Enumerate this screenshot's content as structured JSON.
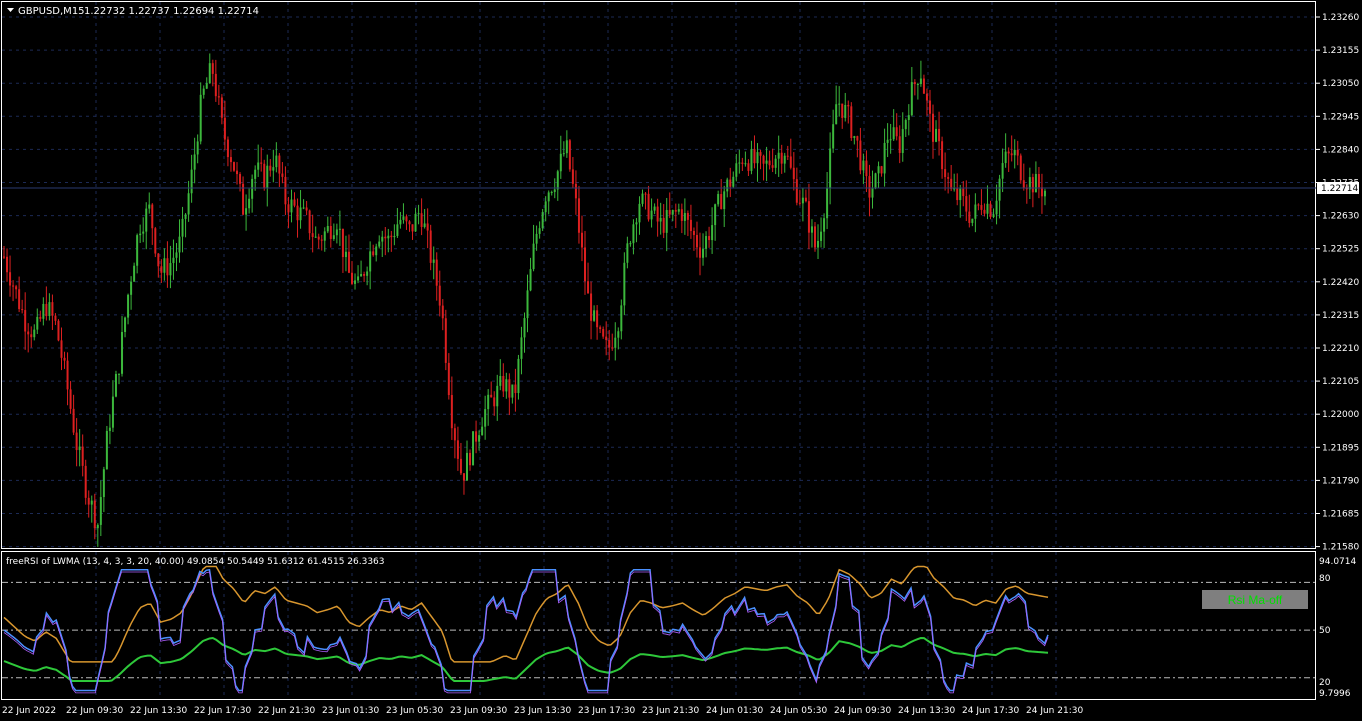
{
  "header": {
    "symbol": "GBPUSD,M15",
    "ohlc": "1.22732 1.22737 1.22694 1.22714"
  },
  "price_axis": {
    "labels": [
      "1.23260",
      "1.23155",
      "1.23050",
      "1.22945",
      "1.22840",
      "1.22735",
      "1.22630",
      "1.22525",
      "1.22420",
      "1.22315",
      "1.22210",
      "1.22105",
      "1.22000",
      "1.21895",
      "1.21790",
      "1.21685",
      "1.21580"
    ],
    "current": "1.22714"
  },
  "indicator": {
    "title": "freeRSI of LWMA (13, 4, 3, 3, 20, 40.00) 49.0854 50.5449 51.6312 61.4515 26.3363",
    "top": "94.0714",
    "levels": [
      "80",
      "50",
      "20"
    ],
    "bottom": "9.7996",
    "button_label": "Rsi Ma-off"
  },
  "time_axis": [
    "22 Jun 2022",
    "22 Jun 09:30",
    "22 Jun 13:30",
    "22 Jun 17:30",
    "22 Jun 21:30",
    "23 Jun 01:30",
    "23 Jun 05:30",
    "23 Jun 09:30",
    "23 Jun 13:30",
    "23 Jun 17:30",
    "23 Jun 21:30",
    "24 Jun 01:30",
    "24 Jun 05:30",
    "24 Jun 09:30",
    "24 Jun 13:30",
    "24 Jun 17:30",
    "24 Jun 21:30"
  ],
  "colors": {
    "bull": "#3cb83c",
    "bear": "#dd2020",
    "rsi_orange": "#d8962e",
    "rsi_green": "#2ec83a",
    "rsi_blue": "#4a90ff",
    "grid": "#1c2a55"
  },
  "chart_data": {
    "type": "candlestick",
    "symbol": "GBPUSD",
    "timeframe": "M15",
    "close_path": [
      1.225,
      1.224,
      1.223,
      1.2225,
      1.2235,
      1.2228,
      1.221,
      1.219,
      1.2175,
      1.2165,
      1.2195,
      1.2215,
      1.224,
      1.226,
      1.2265,
      1.2245,
      1.2248,
      1.2255,
      1.2275,
      1.23,
      1.231,
      1.229,
      1.228,
      1.2265,
      1.2278,
      1.2275,
      1.2282,
      1.2268,
      1.2265,
      1.2262,
      1.2255,
      1.2258,
      1.2262,
      1.2245,
      1.224,
      1.225,
      1.2258,
      1.2255,
      1.2262,
      1.2258,
      1.2265,
      1.225,
      1.2235,
      1.22,
      1.218,
      1.219,
      1.22,
      1.2205,
      1.221,
      1.2205,
      1.223,
      1.2255,
      1.227,
      1.2275,
      1.2285,
      1.2265,
      1.2238,
      1.2225,
      1.222,
      1.223,
      1.2255,
      1.2268,
      1.2265,
      1.226,
      1.2262,
      1.2265,
      1.2258,
      1.2252,
      1.226,
      1.227,
      1.2275,
      1.2282,
      1.228,
      1.2278,
      1.2282,
      1.2284,
      1.2272,
      1.2265,
      1.2252,
      1.227,
      1.23,
      1.2295,
      1.2285,
      1.227,
      1.2275,
      1.229,
      1.2285,
      1.23,
      1.231,
      1.2292,
      1.2282,
      1.227,
      1.2268,
      1.2262,
      1.2268,
      1.2265,
      1.228,
      1.2283,
      1.2275,
      1.2273,
      1.2271
    ],
    "rsi_lines": {
      "levels": [
        80,
        50,
        20
      ],
      "range": [
        9.7996,
        94.0714
      ],
      "last_values": [
        49.0854,
        50.5449,
        51.6312,
        61.4515,
        26.3363
      ]
    }
  }
}
